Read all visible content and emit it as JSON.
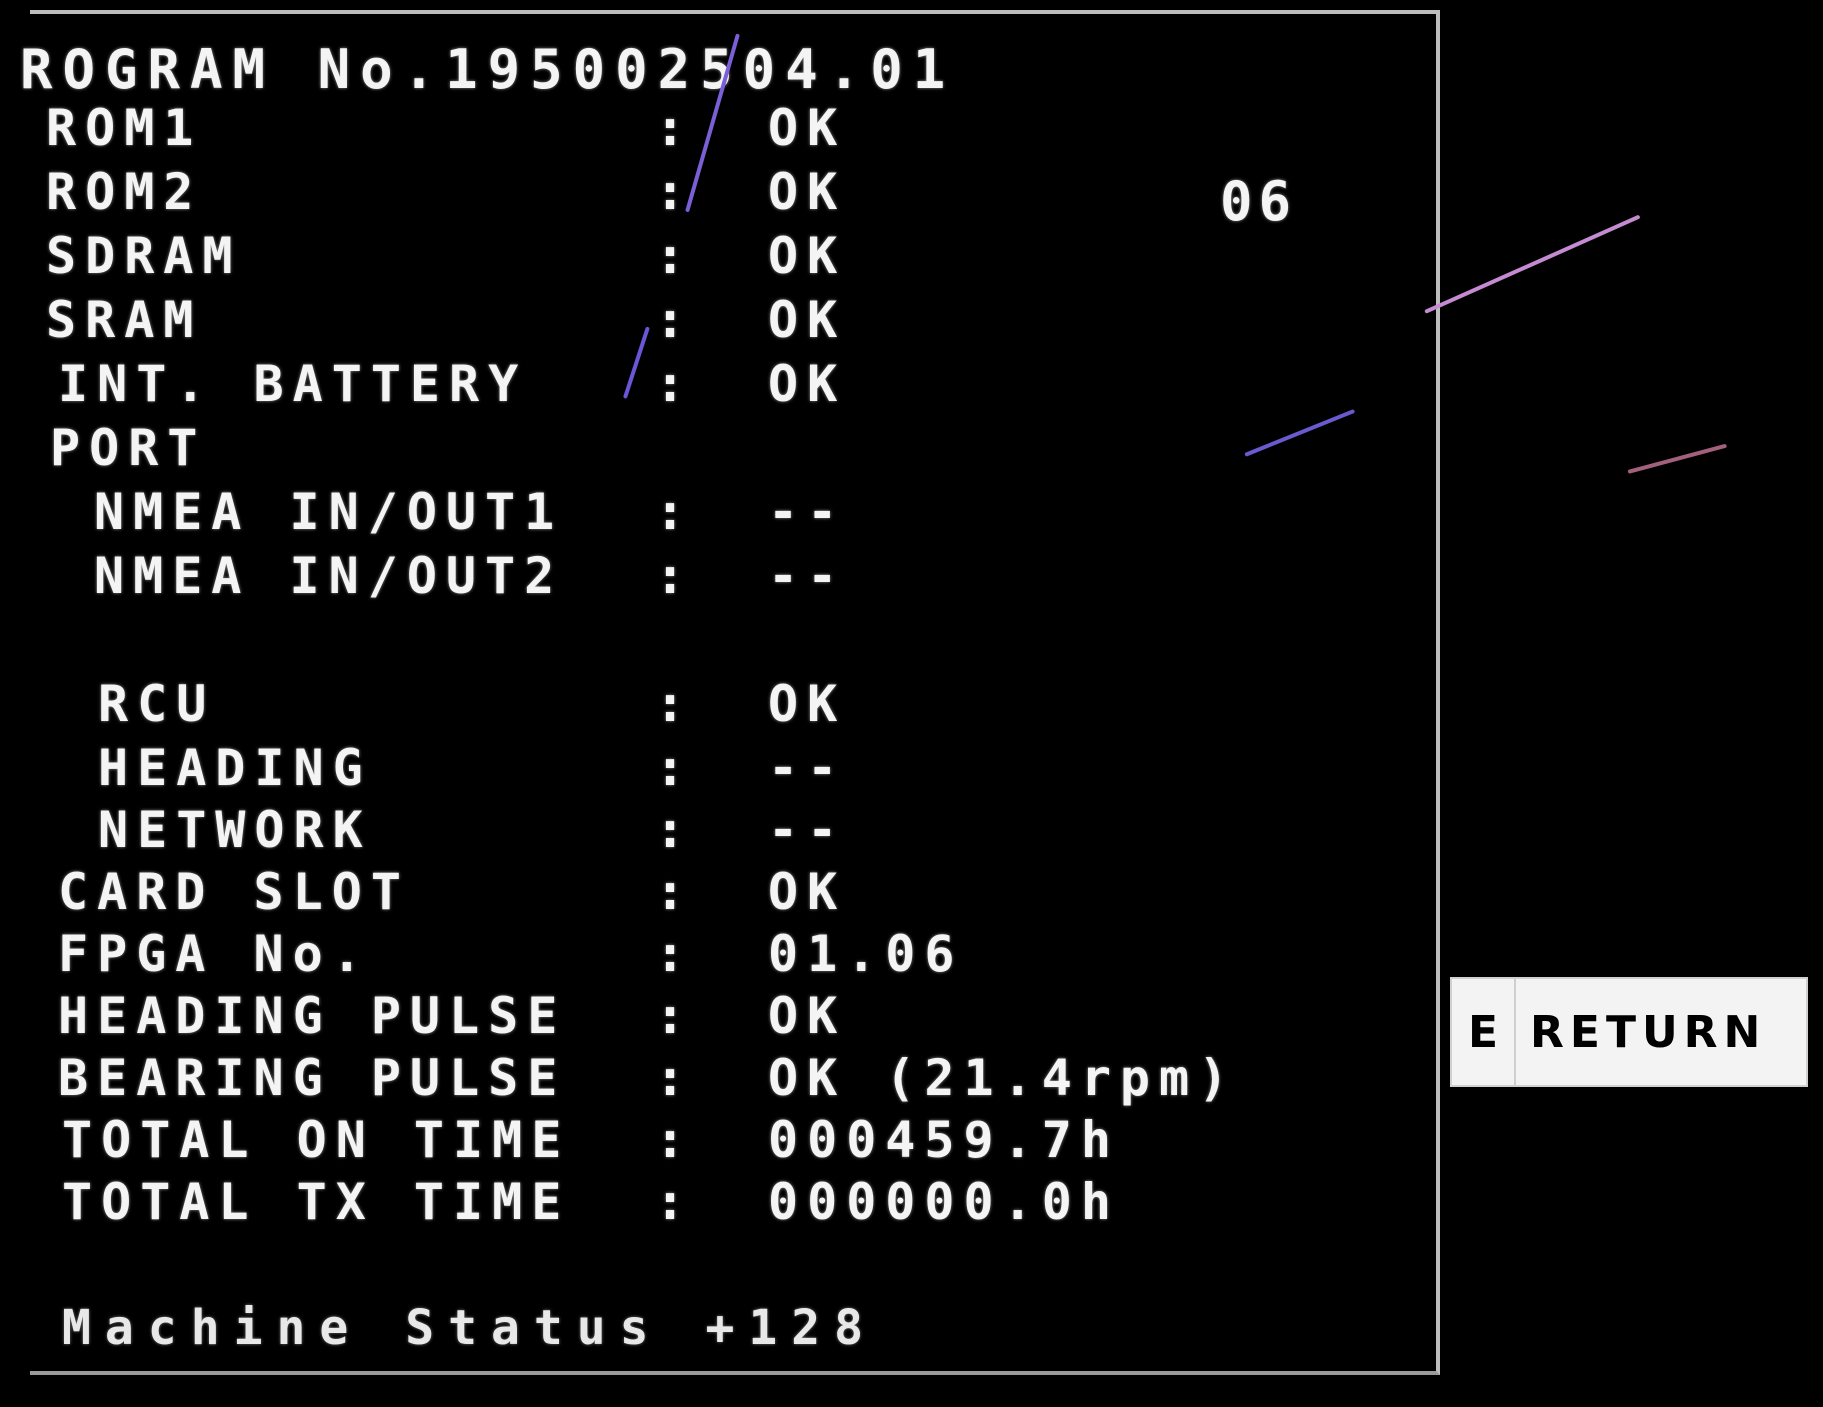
{
  "program": {
    "title": "ROGRAM No.195002504.01",
    "side_value": "06"
  },
  "rows": [
    {
      "label": "ROM1",
      "colon": ":",
      "value": "OK"
    },
    {
      "label": "ROM2",
      "colon": ":",
      "value": "OK"
    },
    {
      "label": "SDRAM",
      "colon": ":",
      "value": "OK"
    },
    {
      "label": "SRAM",
      "colon": ":",
      "value": "OK"
    },
    {
      "label": "INT. BATTERY",
      "colon": ":",
      "value": "OK"
    },
    {
      "label": "PORT",
      "colon": "",
      "value": ""
    },
    {
      "label": "NMEA IN/OUT1",
      "colon": ":",
      "value": "--"
    },
    {
      "label": "NMEA IN/OUT2",
      "colon": ":",
      "value": "--"
    },
    {
      "label": "RCU",
      "colon": ":",
      "value": "OK"
    },
    {
      "label": "HEADING",
      "colon": ":",
      "value": "--"
    },
    {
      "label": "NETWORK",
      "colon": ":",
      "value": "--"
    },
    {
      "label": "CARD SLOT",
      "colon": ":",
      "value": "OK"
    },
    {
      "label": "FPGA No.",
      "colon": ":",
      "value": "01.06"
    },
    {
      "label": "HEADING PULSE",
      "colon": ":",
      "value": "OK"
    },
    {
      "label": "BEARING PULSE",
      "colon": ":",
      "value": "OK (21.4rpm)"
    },
    {
      "label": "TOTAL ON TIME",
      "colon": ":",
      "value": "000459.7h"
    },
    {
      "label": "TOTAL TX TIME",
      "colon": ":",
      "value": "000000.0h"
    }
  ],
  "machine_status": "Machine Status +128",
  "return_button": {
    "key": "E",
    "label": "RETURN"
  },
  "colors": {
    "background": "#000000",
    "text": "#f4f4f4",
    "button_bg": "#f3f3f3"
  }
}
